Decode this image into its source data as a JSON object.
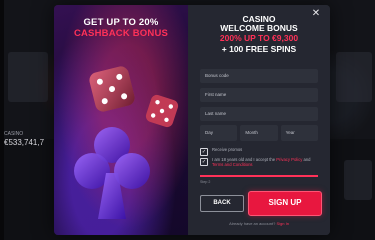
{
  "background": {
    "jackpot_label": "CASINO",
    "jackpot_amount": "€533,741,7"
  },
  "promo": {
    "title_line1": "GET UP TO 20%",
    "title_line2": "CASHBACK BONUS"
  },
  "form": {
    "heading_line1": "CASINO",
    "heading_line2": "WELCOME BONUS",
    "heading_line3": "200% UP TO €9,300",
    "heading_line4": "+ 100 FREE SPINS",
    "bonus_code_placeholder": "Bonus code",
    "first_name_placeholder": "First name",
    "last_name_placeholder": "Last name",
    "day_label": "Day",
    "month_label": "Month",
    "year_label": "Year",
    "promo_checkbox_label": "Receive promos",
    "terms_prefix": "I am 18 years old and I accept the",
    "terms_link1": "Privacy Policy",
    "terms_and": "and",
    "terms_link2": "Terms and Conditions",
    "step_label": "Step 2",
    "back_label": "BACK",
    "signup_label": "SIGN UP",
    "login_prefix": "Already have an account?",
    "login_link": "Sign In",
    "progress_fraction": 1.0,
    "close_glyph": "✕",
    "check_glyph": "✓"
  },
  "colors": {
    "accent": "#ff3158",
    "button": "#e8173f",
    "panel": "#252731"
  },
  "icons": [
    "close-icon",
    "check-icon",
    "dice-icon",
    "club-icon"
  ]
}
